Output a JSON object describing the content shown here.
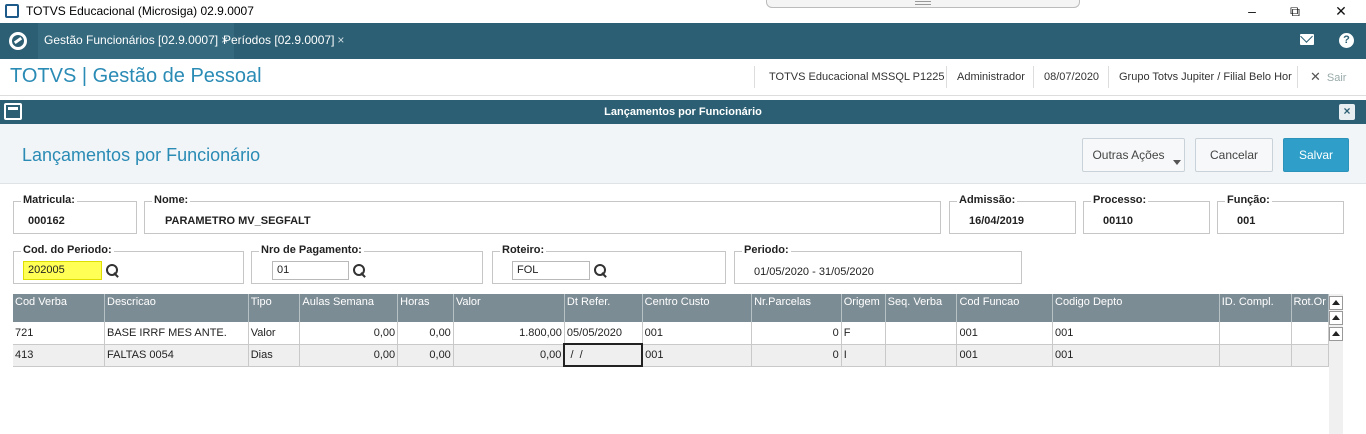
{
  "window": {
    "title": "TOTVS Educacional (Microsiga) 02.9.0007",
    "minimize": "–",
    "restore": "⧉",
    "close": "✕"
  },
  "tabs": [
    {
      "label": "Gestão Funcionários [02.9.0007]",
      "close": "×"
    },
    {
      "label": "Períodos [02.9.0007]",
      "close": "×"
    }
  ],
  "tabbar": {
    "help": "?"
  },
  "header": {
    "brand": "TOTVS | Gestão de Pessoal",
    "environment": "TOTVS Educacional MSSQL P1225",
    "user": "Administrador",
    "date": "08/07/2020",
    "company": "Grupo Totvs Jupiter / Filial Belo Hor",
    "exit_icon": "✕",
    "exit_label": "Sair"
  },
  "dialog": {
    "title": "Lançamentos por Funcionário",
    "close": "×"
  },
  "toolbar": {
    "page_title": "Lançamentos por Funcionário",
    "more_actions": "Outras Ações",
    "cancel": "Cancelar",
    "save": "Salvar"
  },
  "form": {
    "matricula": {
      "label": "Matricula:",
      "value": "000162"
    },
    "nome": {
      "label": "Nome:",
      "value": "PARAMETRO MV_SEGFALT"
    },
    "admissao": {
      "label": "Admissão:",
      "value": "16/04/2019"
    },
    "processo": {
      "label": "Processo:",
      "value": "00110"
    },
    "funcao": {
      "label": "Função:",
      "value": "001"
    },
    "cod_periodo": {
      "label": "Cod. do Periodo:",
      "value": "202005"
    },
    "nro_pagamento": {
      "label": "Nro de Pagamento:",
      "value": "01"
    },
    "roteiro": {
      "label": "Roteiro:",
      "value": "FOL"
    },
    "periodo": {
      "label": "Periodo:",
      "value": "01/05/2020 - 31/05/2020"
    }
  },
  "grid": {
    "columns": [
      "Cod Verba",
      "Descricao",
      "Tipo",
      "Aulas Semana",
      "Horas",
      "Valor",
      "Dt Refer.",
      "Centro Custo",
      "Nr.Parcelas",
      "Origem",
      "Seq. Verba",
      "Cod Funcao",
      "Codigo Depto",
      "ID. Compl.",
      "Rot.Or"
    ],
    "rows": [
      [
        "721",
        "BASE IRRF MES ANTE.",
        "Valor",
        "0,00",
        "0,00",
        "1.800,00",
        "05/05/2020",
        "001",
        "0",
        "F",
        "",
        "001",
        "001",
        "",
        ""
      ],
      [
        "413",
        "FALTAS 0054",
        "Dias",
        "0,00",
        "0,00",
        "0,00",
        " /  /",
        "001",
        "0",
        "I",
        "",
        "001",
        "001",
        "",
        ""
      ]
    ]
  }
}
